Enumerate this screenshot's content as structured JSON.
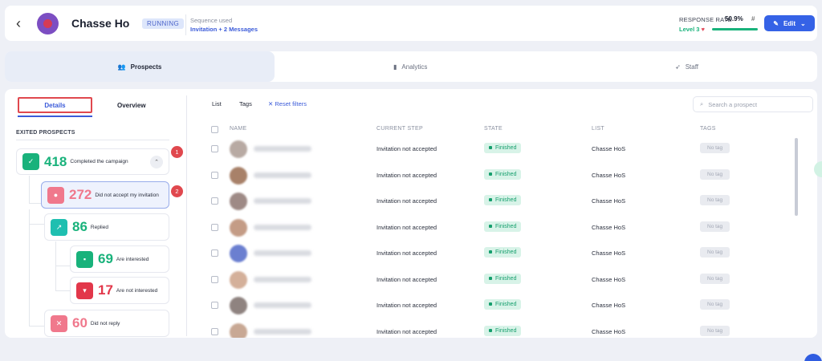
{
  "header": {
    "title": "Chasse Ho",
    "status": "RUNNING",
    "sequence_label": "Sequence used",
    "sequence_value": "Invitation + 2 Messages",
    "response_rate_label": "RESPONSE RATE",
    "response_rate_value": "50.9%",
    "response_rate_symbol": "#",
    "level": "Level 3",
    "level_progress_percent": 100,
    "edit_label": "Edit"
  },
  "tabs": [
    {
      "label": "Prospects",
      "icon": "users-icon",
      "active": true
    },
    {
      "label": "Analytics",
      "icon": "bar-chart-icon",
      "active": false
    },
    {
      "label": "Staff",
      "icon": "rocket-icon",
      "active": false
    }
  ],
  "left": {
    "subtabs": {
      "details": "Details",
      "overview": "Overview"
    },
    "section_label": "EXITED PROSPECTS",
    "nodes": [
      {
        "count": "418",
        "label": "Completed the campaign",
        "icon": "check-icon",
        "color": "#19b27b",
        "num_color": "#19b27b"
      },
      {
        "count": "272",
        "label": "Did not accept my invitation",
        "icon": "user-icon",
        "color": "#f0788c",
        "num_color": "#f0788c"
      },
      {
        "count": "86",
        "label": "Replied",
        "icon": "reply-icon",
        "color": "#1fbfb0",
        "num_color": "#19b27b"
      },
      {
        "count": "69",
        "label": "Are interested",
        "icon": "chat-icon",
        "color": "#19b27b",
        "num_color": "#19b27b"
      },
      {
        "count": "17",
        "label": "Are not interested",
        "icon": "thumbs-down-icon",
        "color": "#e2374a",
        "num_color": "#e2374a"
      },
      {
        "count": "60",
        "label": "Did not reply",
        "icon": "x-icon",
        "color": "#f0788c",
        "num_color": "#f0788c"
      }
    ],
    "markers": [
      "1",
      "2"
    ]
  },
  "filters": {
    "list": "List",
    "tags": "Tags",
    "reset": "Reset filters",
    "search_placeholder": "Search a prospect"
  },
  "table": {
    "columns": [
      "NAME",
      "CURRENT STEP",
      "STATE",
      "LIST",
      "TAGS"
    ],
    "rows": [
      {
        "step": "Invitation not accepted",
        "state": "Finished",
        "list": "Chasse HoS",
        "tag": "No tag",
        "avatar_color": "#b8aaa3"
      },
      {
        "step": "Invitation not accepted",
        "state": "Finished",
        "list": "Chasse HoS",
        "tag": "No tag",
        "avatar_color": "#a88169"
      },
      {
        "step": "Invitation not accepted",
        "state": "Finished",
        "list": "Chasse HoS",
        "tag": "No tag",
        "avatar_color": "#9e8a86"
      },
      {
        "step": "Invitation not accepted",
        "state": "Finished",
        "list": "Chasse HoS",
        "tag": "No tag",
        "avatar_color": "#c49c86"
      },
      {
        "step": "Invitation not accepted",
        "state": "Finished",
        "list": "Chasse HoS",
        "tag": "No tag",
        "avatar_color": "#6b7fd0"
      },
      {
        "step": "Invitation not accepted",
        "state": "Finished",
        "list": "Chasse HoS",
        "tag": "No tag",
        "avatar_color": "#d4b09a"
      },
      {
        "step": "Invitation not accepted",
        "state": "Finished",
        "list": "Chasse HoS",
        "tag": "No tag",
        "avatar_color": "#8f8380"
      },
      {
        "step": "Invitation not accepted",
        "state": "Finished",
        "list": "Chasse HoS",
        "tag": "No tag",
        "avatar_color": "#c8a894"
      }
    ]
  }
}
